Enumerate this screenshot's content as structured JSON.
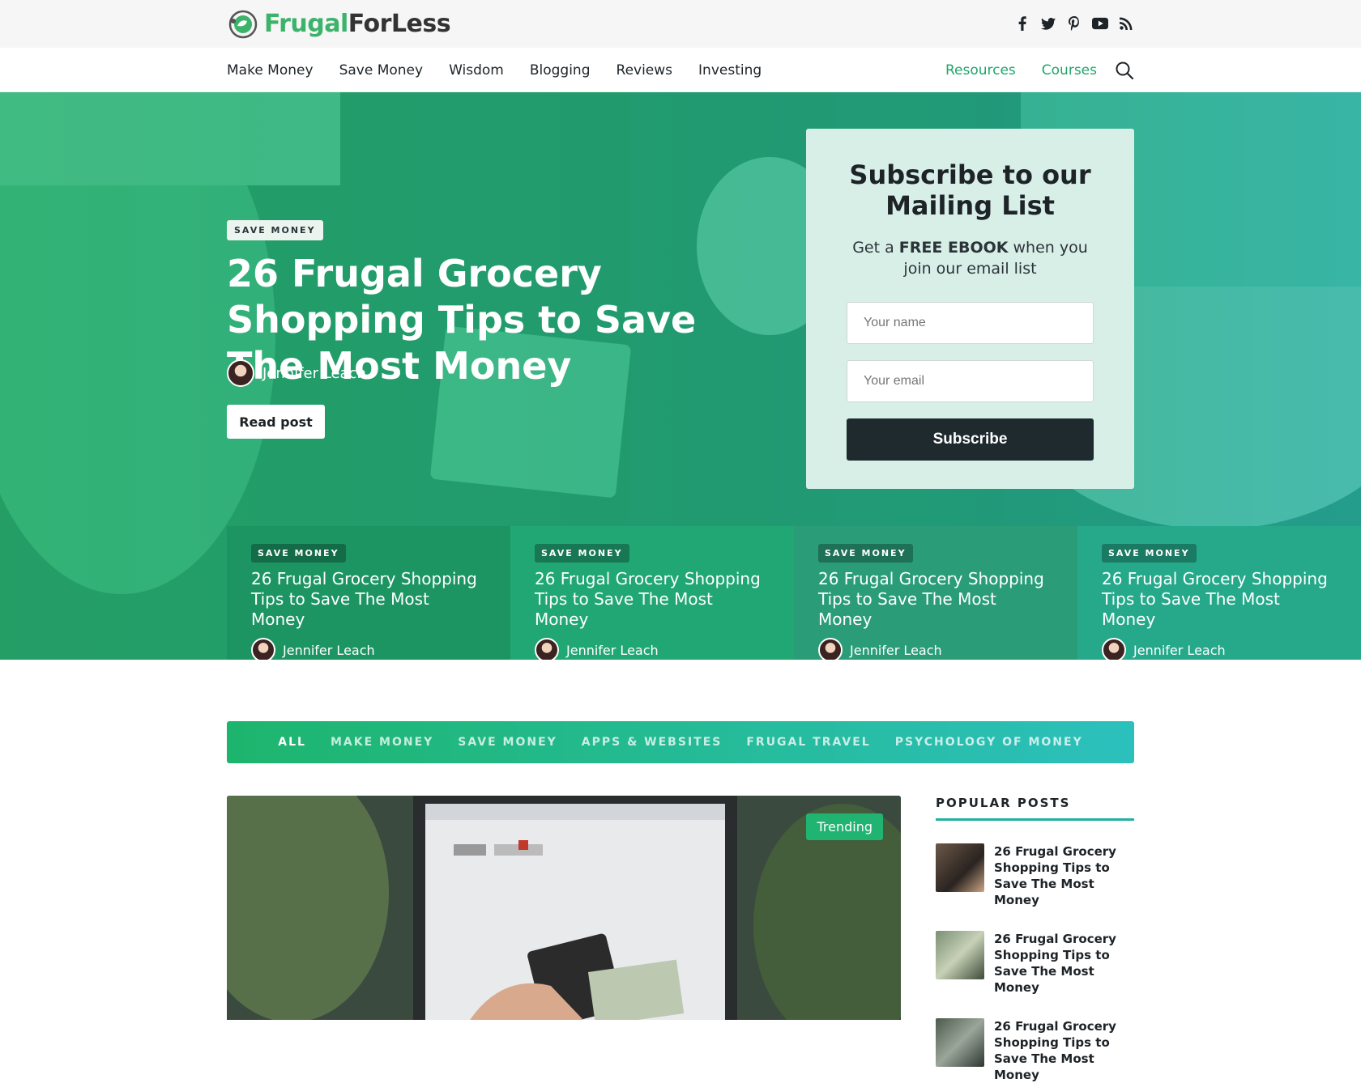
{
  "brand": {
    "name_part1": "Frugal",
    "name_part2": "ForLess",
    "accent_color": "#3bb36b"
  },
  "social_icons": [
    "facebook-icon",
    "twitter-icon",
    "pinterest-icon",
    "youtube-icon",
    "rss-icon"
  ],
  "nav": {
    "left_items": [
      "Make Money",
      "Save Money",
      "Wisdom",
      "Blogging",
      "Reviews",
      "Investing"
    ],
    "right_items": [
      "Resources",
      "Courses"
    ],
    "search_icon": "search-icon"
  },
  "hero": {
    "tag": "SAVE MONEY",
    "title": "26 Frugal Grocery Shopping Tips to Save The Most Money",
    "author": "Jennifer Leach",
    "read_button": "Read post"
  },
  "subscribe": {
    "title": "Subscribe to our Mailing List",
    "text_before": "Get a ",
    "text_bold": "FREE EBOOK",
    "text_after": " when you join our email list",
    "name_placeholder": "Your name",
    "email_placeholder": "Your email",
    "button": "Subscribe"
  },
  "cards": [
    {
      "tag": "SAVE MONEY",
      "title": "26 Frugal Grocery Shopping Tips to Save The Most Money",
      "author": "Jennifer Leach"
    },
    {
      "tag": "SAVE MONEY",
      "title": "26 Frugal Grocery Shopping Tips to Save The Most Money",
      "author": "Jennifer Leach"
    },
    {
      "tag": "SAVE MONEY",
      "title": "26 Frugal Grocery Shopping Tips to Save The Most Money",
      "author": "Jennifer Leach"
    },
    {
      "tag": "SAVE MONEY",
      "title": "26 Frugal Grocery Shopping Tips to Save The Most Money",
      "author": "Jennifer Leach"
    }
  ],
  "categories": {
    "items": [
      "ALL",
      "MAKE MONEY",
      "SAVE MONEY",
      "APPS & WEBSITES",
      "FRUGAL TRAVEL",
      "PSYCHOLOGY OF MONEY"
    ],
    "active": "ALL"
  },
  "feature": {
    "badge": "Trending"
  },
  "sidebar": {
    "heading": "POPULAR POSTS",
    "posts": [
      {
        "title": "26 Frugal Grocery Shopping Tips to Save The Most Money"
      },
      {
        "title": "26 Frugal Grocery Shopping Tips to Save The Most Money"
      },
      {
        "title": "26 Frugal Grocery Shopping Tips to Save The Most Money"
      }
    ]
  }
}
